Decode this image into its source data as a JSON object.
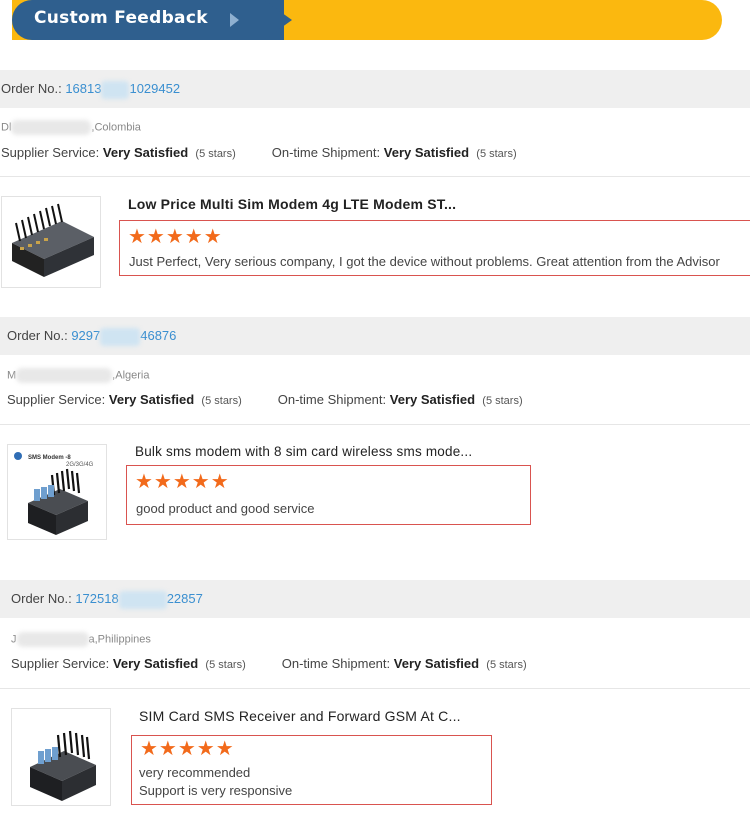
{
  "banner": {
    "title": "Custom Feedback"
  },
  "orders": [
    {
      "order_label": "Order No.:",
      "order_prefix": "16813",
      "order_suffix": "1029452",
      "buyer_prefix": "Dl",
      "buyer_suffix": ",Colombia",
      "supplier_label": "Supplier Service:",
      "supplier_value": "Very Satisfied",
      "supplier_stars": "(5 stars)",
      "shipment_label": "On-time Shipment:",
      "shipment_value": "Very Satisfied",
      "shipment_stars": "(5 stars)",
      "product_title": "Low Price Multi Sim Modem 4g LTE Modem ST...",
      "rating": "★★★★★",
      "review_lines": [
        "Just Perfect, Very serious company, I got the device without problems. Great attention from the Advisor"
      ]
    },
    {
      "order_label": "Order No.:",
      "order_prefix": "9297",
      "order_suffix": "46876",
      "buyer_prefix": "M",
      "buyer_suffix": ",Algeria",
      "supplier_label": "Supplier Service:",
      "supplier_value": "Very Satisfied",
      "supplier_stars": "(5 stars)",
      "shipment_label": "On-time Shipment:",
      "shipment_value": "Very Satisfied",
      "shipment_stars": "(5 stars)",
      "product_title": "Bulk sms modem with 8 sim card wireless sms mode...",
      "thumb_caption_1": "SMS Modem -8",
      "thumb_caption_2": "2G/3G/4G",
      "rating": "★★★★★",
      "review_lines": [
        "good product and good service"
      ]
    },
    {
      "order_label": "Order No.:",
      "order_prefix": "172518",
      "order_suffix": "22857",
      "buyer_prefix": "J",
      "buyer_suffix": "a,Philippines",
      "supplier_label": "Supplier Service:",
      "supplier_value": "Very Satisfied",
      "supplier_stars": "(5 stars)",
      "shipment_label": "On-time Shipment:",
      "shipment_value": "Very Satisfied",
      "shipment_stars": "(5 stars)",
      "product_title": "SIM Card SMS Receiver and Forward GSM At C...",
      "rating": "★★★★★",
      "review_lines": [
        "very recommended",
        "Support is very responsive"
      ]
    }
  ],
  "colors": {
    "banner_blue": "#2f5f8e",
    "banner_yellow": "#fbb80f",
    "order_link": "#3a8fd0",
    "star": "#f26a1b",
    "review_border": "#d9534f"
  }
}
